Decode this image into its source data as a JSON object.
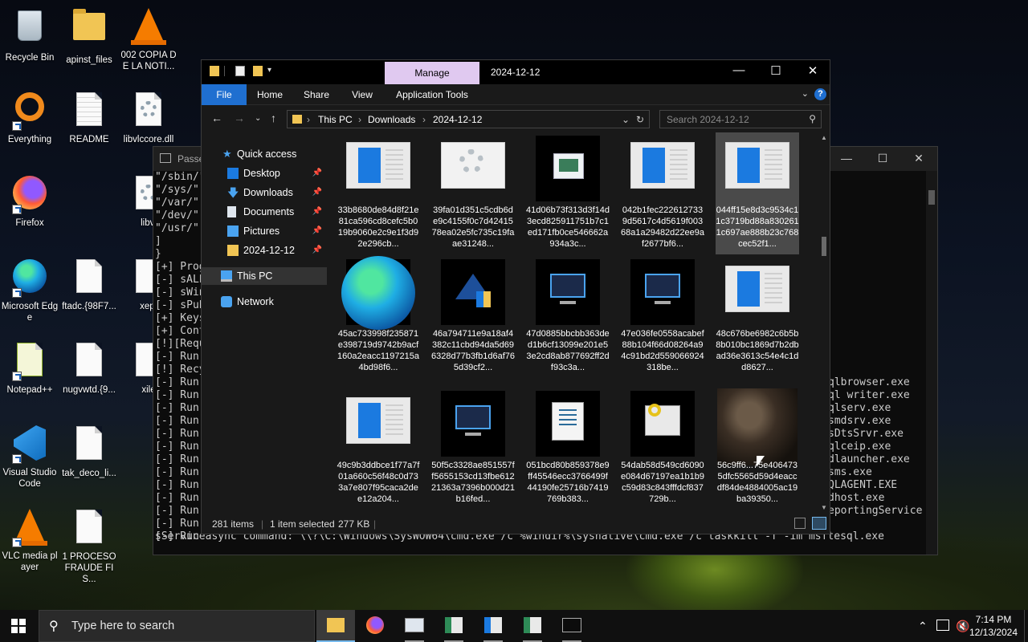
{
  "desktop": {
    "icons": [
      {
        "label": "Recycle Bin",
        "icon": "recycle-bin-icon"
      },
      {
        "label": "apinst_files",
        "icon": "folder-icon"
      },
      {
        "label": "002 COPIA DE LA NOTI...",
        "icon": "vlc-icon"
      },
      {
        "label": "Everything",
        "icon": "everything-search-icon"
      },
      {
        "label": "README",
        "icon": "text-file-icon"
      },
      {
        "label": "libvlccore.dll",
        "icon": "dll-gear-icon"
      },
      {
        "label": "libvl",
        "icon": "dll-gear-icon"
      },
      {
        "label": "Firefox",
        "icon": "firefox-icon"
      },
      {
        "label": "Microsoft Edge",
        "icon": "edge-icon"
      },
      {
        "label": "ftadc.{98F7...",
        "icon": "blank-file-icon"
      },
      {
        "label": "xept",
        "icon": "blank-file-icon"
      },
      {
        "label": "Notepad++",
        "icon": "notepad-plus-plus-icon"
      },
      {
        "label": "nugvwtd.{9...",
        "icon": "blank-file-icon"
      },
      {
        "label": "xile",
        "icon": "blank-file-icon"
      },
      {
        "label": "Visual Studio Code",
        "icon": "vscode-icon"
      },
      {
        "label": "tak_deco_li...",
        "icon": "blank-file-icon"
      },
      {
        "label": "VLC media player",
        "icon": "vlc-icon"
      },
      {
        "label": "1 PROCESO FRAUDE FIS...",
        "icon": "blank-file-icon"
      }
    ]
  },
  "terminal": {
    "title": "Passe",
    "lines": [
      "\"/sbin/\"",
      "\"/sys/\"",
      "\"/var/\"",
      "\"/dev/\"",
      "\"/usr/\"",
      "]",
      "}",
      "[+] Prog",
      "[-] sALL",
      "[-] sWin",
      "[-] sPub",
      "[+] Keys",
      "[+] Cont",
      "[!][Requ",
      "[-] Run",
      "[!] Recy",
      "[-] Run",
      "[-] Run",
      "[-] Run",
      "[-] Run",
      "[-] Run",
      "[-] Run",
      "[-] Run",
      "[-] Run",
      "[-] Run",
      "[-] Run",
      "[-] Run",
      "[-] Run",
      "sService"
    ],
    "right_lines": [
      "qlbrowser.exe",
      "ql writer.exe",
      "qlserv.exe",
      "smdsrv.exe",
      "sDtsSrvr.exe",
      "qlceip.exe",
      "dlauncher.exe",
      "sms.exe",
      "QLAGENT.EXE",
      "dhost.exe",
      "eportingService"
    ],
    "last_command": "[-] Run async command: \\\\?\\C:\\Windows\\SysWOW64\\cmd.exe /c %windir%\\sysnative\\cmd.exe /c taskkill -f -im msftesql.exe"
  },
  "explorer": {
    "title_path": "2024-12-12",
    "manage_tab": "Manage",
    "ribbon_tabs": [
      "File",
      "Home",
      "Share",
      "View",
      "Application Tools"
    ],
    "breadcrumb": [
      "This PC",
      "Downloads",
      "2024-12-12"
    ],
    "search_placeholder": "Search 2024-12-12",
    "nav": {
      "quick_access": "Quick access",
      "items": [
        "Desktop",
        "Downloads",
        "Documents",
        "Pictures",
        "2024-12-12"
      ],
      "this_pc": "This PC",
      "network": "Network"
    },
    "files": [
      {
        "name": "33b8680de84d8f21e81ca596cd8cefc5b019b9060e2c9e1f3d92e296cb...",
        "thumb": "document"
      },
      {
        "name": "39fa01d351c5cdb6de9c4155f0c7d4241578ea02e5fc735c19faae31248...",
        "thumb": "gear"
      },
      {
        "name": "41d06b73f313d3f14d3ecd825911751b7c1ed171fb0ce546662a934a3c...",
        "thumb": "window"
      },
      {
        "name": "042b1fec2226127339d5617c4d5619f00368a1a29482d22ee9af2677bf6...",
        "thumb": "document"
      },
      {
        "name": "044ff15e8d3c9534c11c3719bd88a8302611c697ae888b23c768cec52f1...",
        "thumb": "document"
      },
      {
        "name": "45ac733998f235871e398719d9742b9acf160a2eacc1197215a4bd98f6...",
        "thumb": "edge"
      },
      {
        "name": "46a794711e9a18af4382c11cbd94da5d696328d77b3fb1d6af765d39cf2...",
        "thumb": "shield"
      },
      {
        "name": "47d0885bbcbb363ded1b6cf13099e201e53e2cd8ab877692ff2df93c3a...",
        "thumb": "monitor"
      },
      {
        "name": "47e036fe0558acabef88b104f66d08264a94c91bd2d559066924318be...",
        "thumb": "monitor"
      },
      {
        "name": "48c676be6982c6b5b8b010bc1869d7b2dbad36e3613c54e4c1dd8627...",
        "thumb": "document"
      },
      {
        "name": "49c9b3ddbce1f77a7f01a660c56f48c0d733a7e807f95caca2dee12a204...",
        "thumb": "document"
      },
      {
        "name": "50f5c3328ae851557ff5655153cd13fbe61221363a7396b000d21b16fed...",
        "thumb": "monitor"
      },
      {
        "name": "051bcd80b859378e9ff45546ecc3766499f44190fe25716b7419769b383...",
        "thumb": "script"
      },
      {
        "name": "54dab58d549cd6090e084d67197ea1b1b9c59d83c843fffdcf837729b...",
        "thumb": "key"
      },
      {
        "name": "56c9ff6...75e4064735dfc5565d59d4eaccdf84de4884005ac19ba39350...",
        "thumb": "photo"
      }
    ],
    "status": {
      "items": "281 items",
      "selected": "1 item selected",
      "size": "277 KB"
    }
  },
  "taskbar": {
    "search_placeholder": "Type here to search",
    "time": "7:14 PM",
    "date": "12/13/2024"
  },
  "colors": {
    "accent": "#1f6fd0",
    "manage_tab": "#e0c9f0",
    "explorer_bg": "#191919",
    "terminal_bg": "#0c0c0c"
  }
}
